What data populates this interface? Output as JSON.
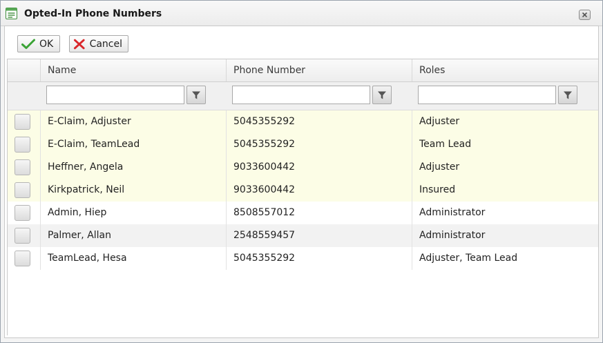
{
  "window": {
    "title": "Opted-In Phone Numbers",
    "icon": "list-document-icon",
    "close_icon": "close-icon"
  },
  "toolbar": {
    "ok_label": "OK",
    "cancel_label": "Cancel",
    "ok_icon": "checkmark-icon",
    "cancel_icon": "x-icon",
    "accent_ok": "#3aa335",
    "accent_cancel": "#d9262a"
  },
  "grid": {
    "columns": [
      "Name",
      "Phone Number",
      "Roles"
    ],
    "filters": {
      "name": "",
      "phone": "",
      "roles": ""
    },
    "filter_icon": "funnel-icon",
    "highlight_color": "#fcfde6",
    "rows": [
      {
        "name": "E-Claim, Adjuster",
        "phone": "5045355292",
        "roles": "Adjuster",
        "style": "hl"
      },
      {
        "name": "E-Claim, TeamLead",
        "phone": "5045355292",
        "roles": "Team Lead",
        "style": "hl"
      },
      {
        "name": "Heffner, Angela",
        "phone": "9033600442",
        "roles": "Adjuster",
        "style": "hl"
      },
      {
        "name": "Kirkpatrick, Neil",
        "phone": "9033600442",
        "roles": "Insured",
        "style": "hl"
      },
      {
        "name": "Admin, Hiep",
        "phone": "8508557012",
        "roles": "Administrator",
        "style": "plain"
      },
      {
        "name": "Palmer, Allan",
        "phone": "2548559457",
        "roles": "Administrator",
        "style": "alt"
      },
      {
        "name": "TeamLead, Hesa",
        "phone": "5045355292",
        "roles": "Adjuster, Team Lead",
        "style": "plain"
      }
    ]
  }
}
